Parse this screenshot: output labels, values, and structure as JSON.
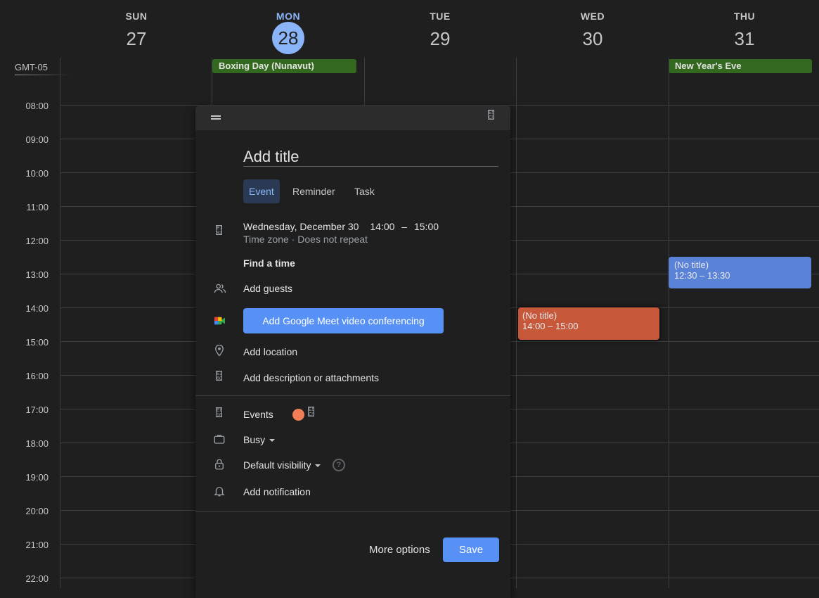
{
  "header": {
    "days": [
      {
        "name": "SUN",
        "num": "27"
      },
      {
        "name": "MON",
        "num": "28"
      },
      {
        "name": "TUE",
        "num": "29"
      },
      {
        "name": "WED",
        "num": "30"
      },
      {
        "name": "THU",
        "num": "31"
      }
    ],
    "timezone": "GMT-05"
  },
  "allday": {
    "boxing_day": "Boxing Day (Nunavut)",
    "new_years_eve": "New Year's Eve"
  },
  "hours": [
    "08:00",
    "09:00",
    "10:00",
    "11:00",
    "12:00",
    "13:00",
    "14:00",
    "15:00",
    "16:00",
    "17:00",
    "18:00",
    "19:00",
    "20:00",
    "21:00",
    "22:00"
  ],
  "events": {
    "wed": {
      "title": "(No title)",
      "time": "14:00 – 15:00"
    },
    "thu": {
      "title": "(No title)",
      "time": "12:30 – 13:30"
    }
  },
  "dialog": {
    "title_placeholder": "Add title",
    "tabs": [
      "Event",
      "Reminder",
      "Task"
    ],
    "date": "Wednesday, December 30",
    "start": "14:00",
    "dash": "–",
    "end": "15:00",
    "timezone_repeat": "Time zone · Does not repeat",
    "find_time": "Find a time",
    "add_guests": "Add guests",
    "meet": "Add Google Meet video conferencing",
    "add_location": "Add location",
    "add_description": "Add description or attachments",
    "calendar": "Events",
    "busy": "Busy",
    "visibility": "Default visibility",
    "help": "?",
    "notification": "Add notification",
    "more_options": "More options",
    "save": "Save"
  },
  "colors": {
    "accent": "#8ab4f8",
    "button": "#5791f5",
    "holiday": "#33691e",
    "event_orange": "#c8583a",
    "event_blue": "#5a82d6",
    "calendar_dot": "#f07f58"
  }
}
